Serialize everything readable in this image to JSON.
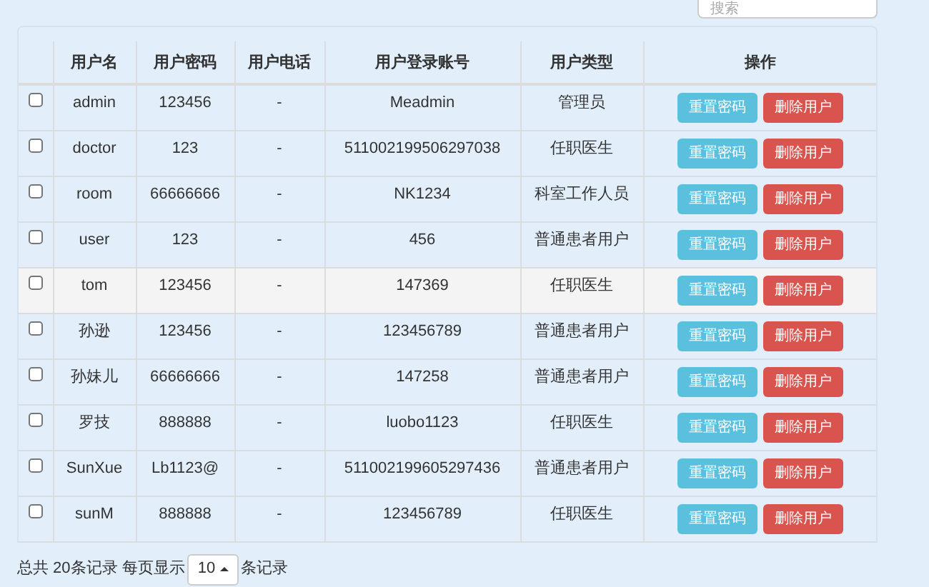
{
  "search": {
    "placeholder": "搜索"
  },
  "table": {
    "columns": [
      "用户名",
      "用户密码",
      "用户电话",
      "用户登录账号",
      "用户类型",
      "操作"
    ],
    "rows": [
      {
        "checked": false,
        "highlighted": false,
        "cells": [
          "admin",
          "123456",
          "-",
          "Meadmin",
          "管理员"
        ],
        "actions": [
          "重置密码",
          "删除用户"
        ]
      },
      {
        "checked": false,
        "highlighted": false,
        "cells": [
          "doctor",
          "123",
          "-",
          "511002199506297038",
          "任职医生"
        ],
        "actions": [
          "重置密码",
          "删除用户"
        ]
      },
      {
        "checked": false,
        "highlighted": false,
        "cells": [
          "room",
          "66666666",
          "-",
          "NK1234",
          "科室工作人员"
        ],
        "actions": [
          "重置密码",
          "删除用户"
        ]
      },
      {
        "checked": false,
        "highlighted": false,
        "cells": [
          "user",
          "123",
          "-",
          "456",
          "普通患者用户"
        ],
        "actions": [
          "重置密码",
          "删除用户"
        ]
      },
      {
        "checked": false,
        "highlighted": true,
        "cells": [
          "tom",
          "123456",
          "-",
          "147369",
          "任职医生"
        ],
        "actions": [
          "重置密码",
          "删除用户"
        ]
      },
      {
        "checked": false,
        "highlighted": false,
        "cells": [
          "孙逊",
          "123456",
          "-",
          "123456789",
          "普通患者用户"
        ],
        "actions": [
          "重置密码",
          "删除用户"
        ]
      },
      {
        "checked": false,
        "highlighted": false,
        "cells": [
          "孙妹儿",
          "66666666",
          "-",
          "147258",
          "普通患者用户"
        ],
        "actions": [
          "重置密码",
          "删除用户"
        ]
      },
      {
        "checked": false,
        "highlighted": false,
        "cells": [
          "罗技",
          "888888",
          "-",
          "luobo1123",
          "任职医生"
        ],
        "actions": [
          "重置密码",
          "删除用户"
        ]
      },
      {
        "checked": false,
        "highlighted": false,
        "cells": [
          "SunXue",
          "Lb1123@",
          "-",
          "511002199605297436",
          "普通患者用户"
        ],
        "actions": [
          "重置密码",
          "删除用户"
        ]
      },
      {
        "checked": false,
        "highlighted": false,
        "cells": [
          "sunM",
          "888888",
          "-",
          "123456789",
          "任职医生"
        ],
        "actions": [
          "重置密码",
          "删除用户"
        ]
      }
    ]
  },
  "footer": {
    "total": "总共 20条记录 每页显示",
    "page_size": "10",
    "suffix": "条记录"
  }
}
